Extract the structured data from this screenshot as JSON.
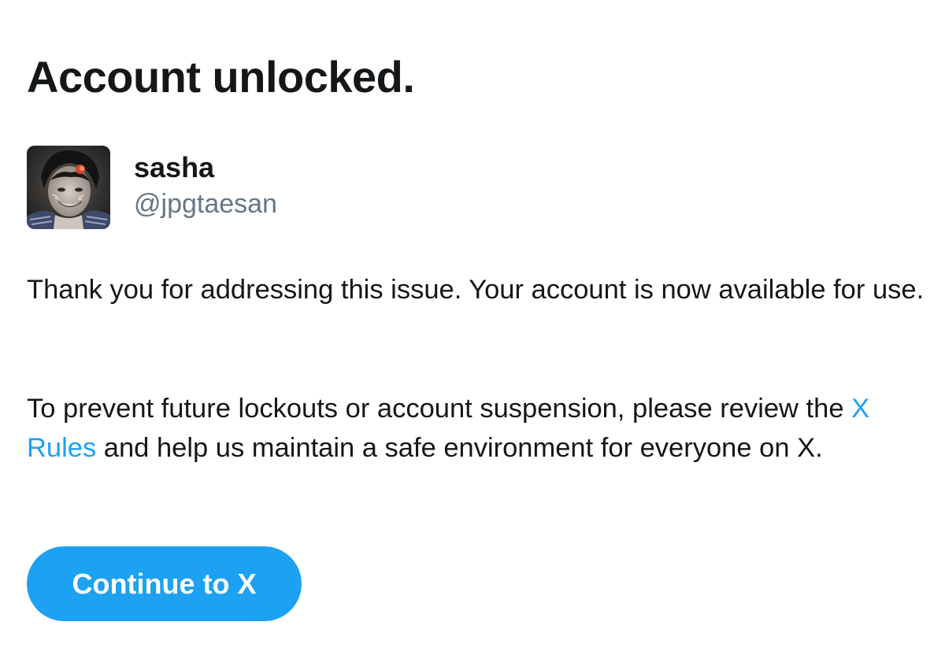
{
  "heading": "Account unlocked.",
  "user": {
    "display_name": "sasha",
    "handle": "@jpgtaesan"
  },
  "message": {
    "paragraph1": "Thank you for addressing this issue. Your account is now available for use.",
    "paragraph2_before": "To prevent future lockouts or account suspension, please review the ",
    "paragraph2_link": "X Rules",
    "paragraph2_after": " and help us maintain a safe environment for everyone on X."
  },
  "button": {
    "label": "Continue to X"
  },
  "colors": {
    "accent": "#1da1f2",
    "text": "#14171a",
    "muted": "#657786",
    "background": "#ffffff"
  }
}
